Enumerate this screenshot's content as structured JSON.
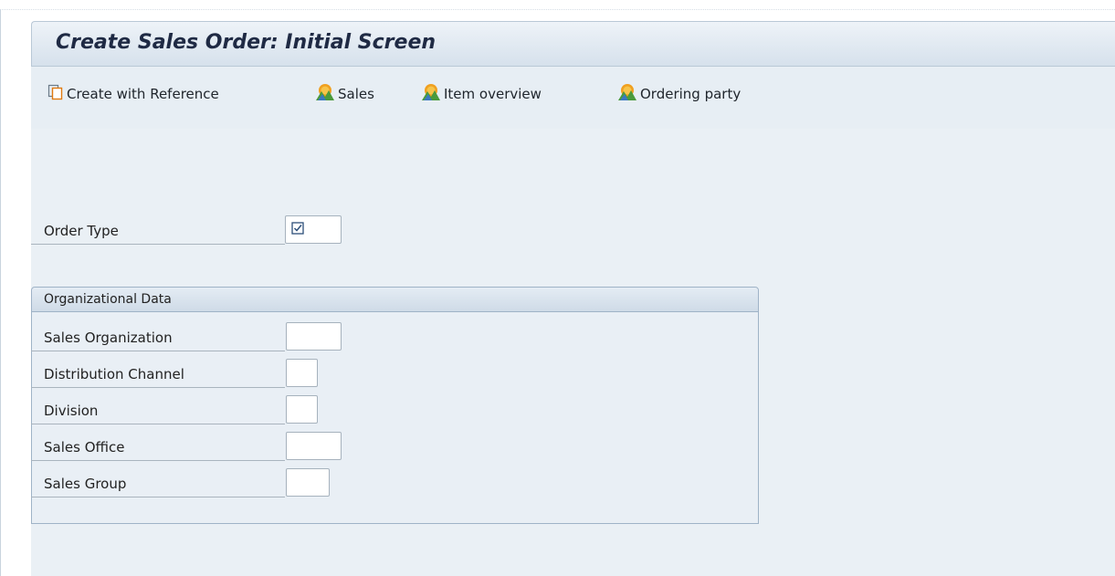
{
  "header": {
    "title": "Create Sales Order: Initial Screen"
  },
  "toolbar": {
    "items": [
      {
        "label": "Create with Reference",
        "icon": "copy-document-icon"
      },
      {
        "label": "Sales",
        "icon": "overview-mountain-icon"
      },
      {
        "label": "Item overview",
        "icon": "overview-mountain-icon"
      },
      {
        "label": "Ordering party",
        "icon": "overview-mountain-icon"
      }
    ]
  },
  "order_type": {
    "label": "Order Type",
    "value": ""
  },
  "org_data": {
    "title": "Organizational Data",
    "fields": [
      {
        "label": "Sales Organization",
        "value": ""
      },
      {
        "label": "Distribution Channel",
        "value": ""
      },
      {
        "label": "Division",
        "value": ""
      },
      {
        "label": "Sales Office",
        "value": ""
      },
      {
        "label": "Sales Group",
        "value": ""
      }
    ]
  },
  "colors": {
    "title_text": "#1f2a44",
    "toolbar_bg": "#e7eef4",
    "content_bg": "#eaf0f5",
    "icon_orange": "#f0a020",
    "icon_green": "#4a9a3c",
    "icon_blue": "#3a78c0"
  }
}
